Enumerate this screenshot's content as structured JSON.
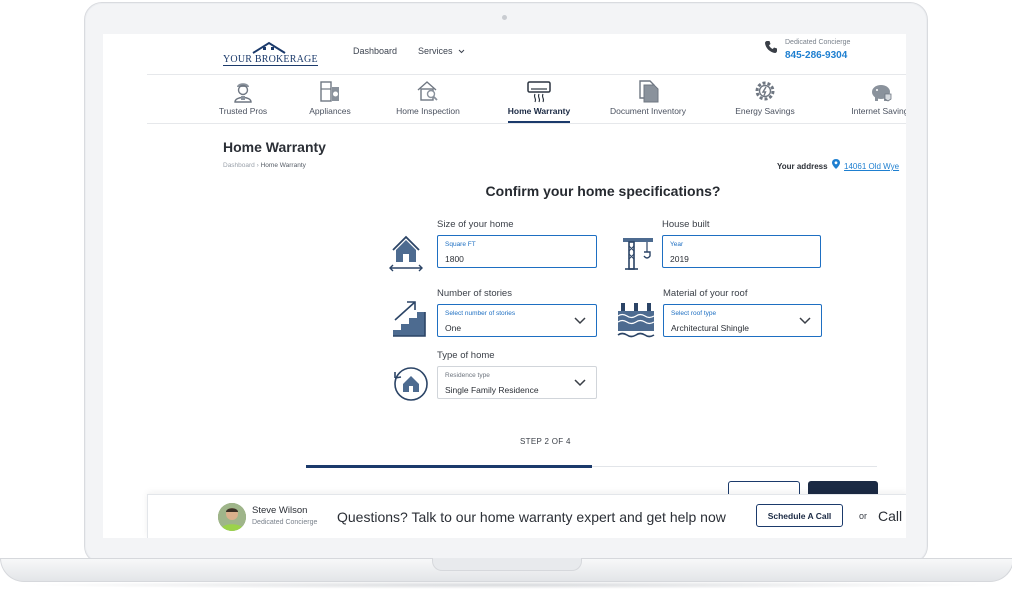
{
  "header": {
    "logo_text": "YOUR BROKERAGE",
    "nav": [
      "Dashboard",
      "Services"
    ],
    "concierge_label": "Dedicated Concierge",
    "phone": "845-286-9304"
  },
  "categories": [
    {
      "label": "Trusted Pros",
      "icon": "worker-icon"
    },
    {
      "label": "Appliances",
      "icon": "appliances-icon"
    },
    {
      "label": "Home Inspection",
      "icon": "home-inspection-icon"
    },
    {
      "label": "Home Warranty",
      "icon": "air-conditioner-icon",
      "active": true
    },
    {
      "label": "Document Inventory",
      "icon": "documents-icon"
    },
    {
      "label": "Energy Savings",
      "icon": "energy-gear-icon"
    },
    {
      "label": "Internet Savings",
      "icon": "piggy-bank-icon"
    }
  ],
  "page": {
    "title": "Home Warranty",
    "breadcrumb": {
      "root": "Dashboard",
      "sep": "›",
      "current": "Home Warranty"
    },
    "address_label": "Your address",
    "address_value": "14061 Old Wye"
  },
  "form": {
    "question": "Confirm your home specifications?",
    "size": {
      "label": "Size of your home",
      "mini": "Square FT",
      "value": "1800"
    },
    "built": {
      "label": "House built",
      "mini": "Year",
      "value": "2019"
    },
    "stories": {
      "label": "Number of stories",
      "mini": "Select number of stories",
      "value": "One"
    },
    "roof": {
      "label": "Material of your roof",
      "mini": "Select roof type",
      "value": "Architectural Shingle"
    },
    "home_type": {
      "label": "Type of home",
      "mini": "Residence type",
      "value": "Single Family Residence"
    },
    "step_text": "STEP 2 OF 4",
    "progress_fraction": 0.5
  },
  "footer": {
    "agent_name": "Steve Wilson",
    "agent_role": "Dedicated Concierge",
    "cta": "Questions? Talk to our home warranty expert and get help now",
    "schedule_label": "Schedule A Call",
    "or_label": "or",
    "call_label": "Call"
  },
  "colors": {
    "brand_navy": "#1b3a6b",
    "link_blue": "#1e7fd0",
    "field_blue": "#1e6fc2"
  }
}
